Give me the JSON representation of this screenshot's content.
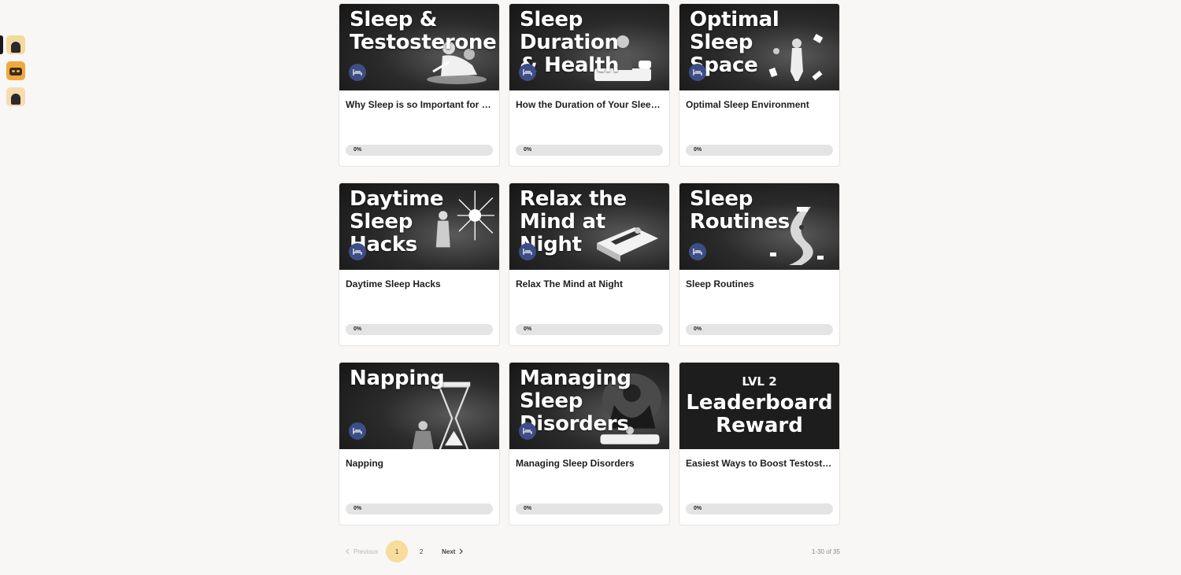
{
  "rail": {
    "items": [
      {
        "name": "community-avatar-1",
        "bg": "#f4d9a0",
        "kind": "fig",
        "active": true
      },
      {
        "name": "community-avatar-2",
        "bg": "#f2a93b",
        "kind": "cat",
        "active": false
      },
      {
        "name": "community-avatar-3",
        "bg": "#f6dcae",
        "kind": "fig",
        "active": false
      }
    ]
  },
  "cards": [
    {
      "banner": "Sleep &\nTestosterone",
      "title": "Why Sleep is so Important for Testosterone",
      "progress_label": "0%",
      "progress": 0
    },
    {
      "banner": "Sleep Duration\n& Health",
      "title": "How the Duration of Your Sleep Affects Your Health",
      "progress_label": "0%",
      "progress": 0
    },
    {
      "banner": "Optimal Sleep\nSpace",
      "title": "Optimal Sleep Environment",
      "progress_label": "0%",
      "progress": 0
    },
    {
      "banner": "Daytime\nSleep\n     Hacks",
      "title": "Daytime Sleep Hacks",
      "progress_label": "0%",
      "progress": 0
    },
    {
      "banner": "Relax the\nMind at Night",
      "title": "Relax The Mind at Night",
      "progress_label": "0%",
      "progress": 0
    },
    {
      "banner": "Sleep\nRoutines",
      "title": "Sleep Routines",
      "progress_label": "0%",
      "progress": 0
    },
    {
      "banner": "Napping",
      "title": "Napping",
      "progress_label": "0%",
      "progress": 0
    },
    {
      "banner": "Managing\nSleep\nDisorders",
      "title": "Managing Sleep Disorders",
      "progress_label": "0%",
      "progress": 0
    },
    {
      "banner_lvl": "LVL 2",
      "banner": "Leaderboard\nReward",
      "title": "Easiest Ways to Boost Testosterone",
      "progress_label": "0%",
      "progress": 0,
      "is_reward": true
    }
  ],
  "pagination": {
    "previous_label": "Previous",
    "pages": [
      "1",
      "2"
    ],
    "current_page": "1",
    "next_label": "Next",
    "count_text": "1-30 of 35"
  },
  "colors": {
    "badge": "#3d4e86",
    "active_page": "#f7dc9c",
    "progress_track": "#e4e4e4"
  },
  "icons": {
    "category_badge": "bed-icon",
    "previous": "chevron-left-icon",
    "next": "chevron-right-icon"
  }
}
